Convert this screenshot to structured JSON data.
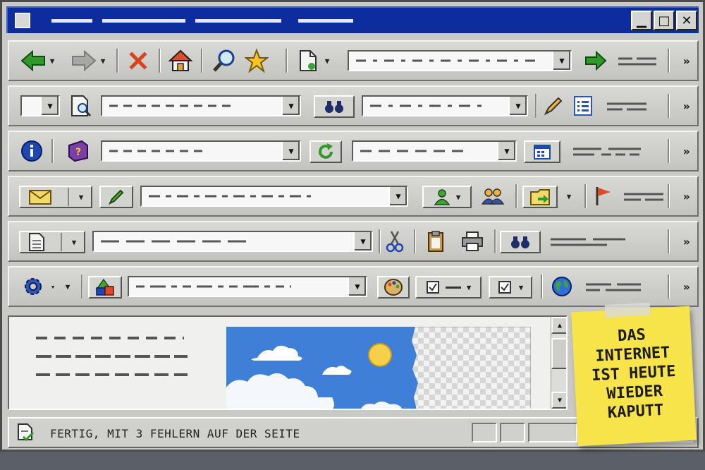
{
  "window": {
    "controls": {
      "minimize": "▁",
      "maximize": "□",
      "close": "✕"
    }
  },
  "toolbars": {
    "more": "»"
  },
  "status": {
    "text": "FERTIG, MIT 3 FEHLERN AUF DER SEITE"
  },
  "sticky_note": {
    "text": "DAS\nINTERNET\nIST HEUTE\nWIEDER\nKAPUTT"
  },
  "colors": {
    "titlebar": "#0d2d9f",
    "back_arrow": "#2f9a2a",
    "sticky": "#f7e34a",
    "stop": "#d8401e"
  },
  "icons": [
    "back-arrow-icon",
    "forward-arrow-icon",
    "stop-icon",
    "home-icon",
    "search-icon",
    "favorites-star-icon",
    "new-page-icon",
    "go-arrow-icon",
    "page-search-icon",
    "binoculars-icon",
    "pencil-icon",
    "list-icon",
    "info-icon",
    "help-book-icon",
    "refresh-icon",
    "calendar-icon",
    "mail-icon",
    "edit-icon",
    "user-icon",
    "users-icon",
    "folder-export-icon",
    "flag-icon",
    "document-icon",
    "scissors-icon",
    "clipboard-icon",
    "printer-icon",
    "gear-icon",
    "shapes-icon",
    "palette-icon",
    "checkbox-icon",
    "globe-icon",
    "status-page-icon"
  ]
}
